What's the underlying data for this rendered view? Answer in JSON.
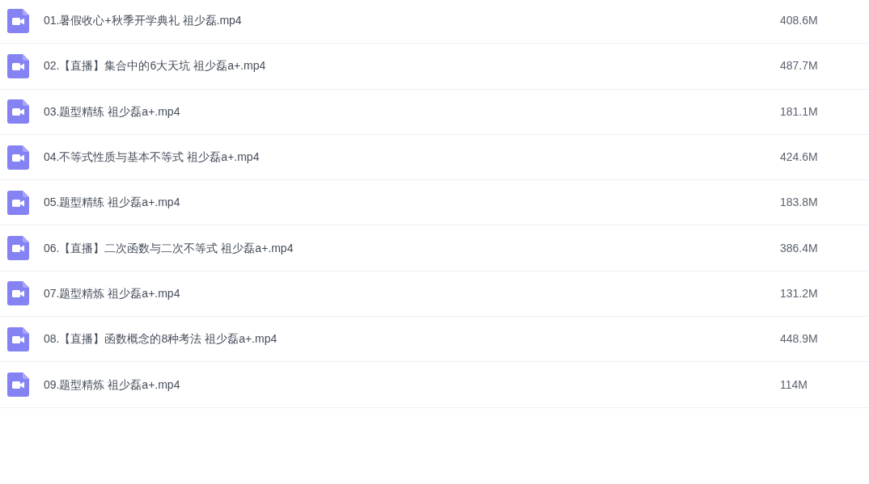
{
  "files": [
    {
      "name": "01.暑假收心+秋季开学典礼 祖少磊.mp4",
      "size": "408.6M"
    },
    {
      "name": "02.【直播】集合中的6大天坑 祖少磊a+.mp4",
      "size": "487.7M"
    },
    {
      "name": "03.题型精练 祖少磊a+.mp4",
      "size": "181.1M"
    },
    {
      "name": "04.不等式性质与基本不等式 祖少磊a+.mp4",
      "size": "424.6M"
    },
    {
      "name": "05.题型精练 祖少磊a+.mp4",
      "size": "183.8M"
    },
    {
      "name": "06.【直播】二次函数与二次不等式 祖少磊a+.mp4",
      "size": "386.4M"
    },
    {
      "name": "07.题型精炼 祖少磊a+.mp4",
      "size": "131.2M"
    },
    {
      "name": "08.【直播】函数概念的8种考法 祖少磊a+.mp4",
      "size": "448.9M"
    },
    {
      "name": "09.题型精炼 祖少磊a+.mp4",
      "size": "114M"
    }
  ]
}
